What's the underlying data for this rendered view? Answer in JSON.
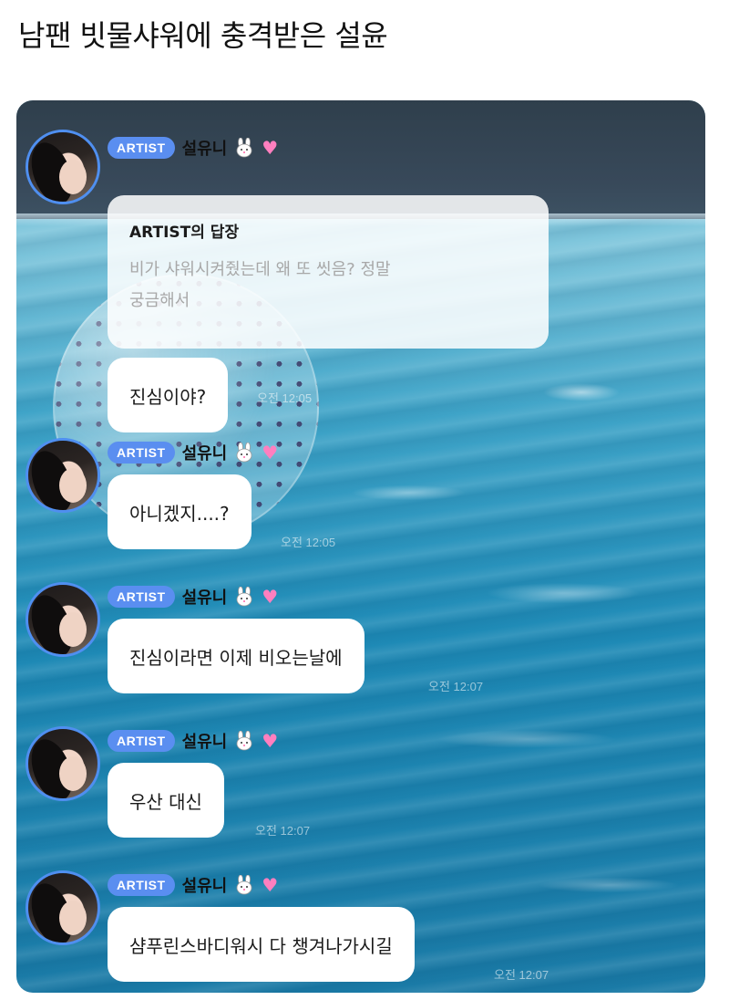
{
  "post": {
    "title": "남팬 빗물샤워에 충격받은 설윤"
  },
  "chat": {
    "badge": "ARTIST",
    "sender": "설유니",
    "reply": {
      "title": "ARTIST의 답장",
      "text_line1": "비가 샤워시켜줬는데 왜 또 씻음? 정말",
      "text_line2": "궁금해서"
    },
    "messages": [
      {
        "text": "진심이야?",
        "time": "오전 12:05"
      },
      {
        "text": "아니겠지....?",
        "time": "오전 12:05"
      },
      {
        "text": "진심이라면 이제 비오는날에",
        "time": "오전 12:07"
      },
      {
        "text": "우산 대신",
        "time": "오전 12:07"
      },
      {
        "text": "샴푸린스바디워시 다 챙겨나가시길",
        "time": "오전 12:07"
      }
    ],
    "icons": {
      "bunny": "rabbit-face-icon",
      "heart": "pink-heart-icon"
    },
    "colors": {
      "badge": "#5a8ef0",
      "avatar_ring": "#4f8ff0",
      "heart": "#ff7fbf"
    }
  }
}
